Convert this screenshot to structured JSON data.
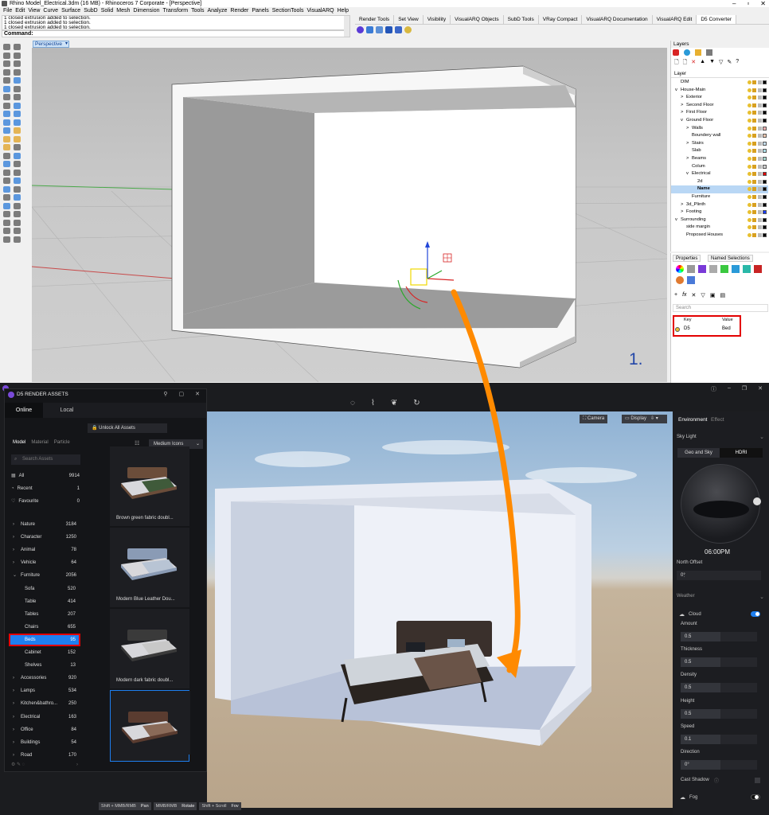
{
  "rhino": {
    "title": "Rhino Model_Electrical.3dm (16 MB) - Rhinoceros 7 Corporate - [Perspective]",
    "menu": [
      "File",
      "Edit",
      "View",
      "Curve",
      "Surface",
      "SubD",
      "Solid",
      "Mesh",
      "Dimension",
      "Transform",
      "Tools",
      "Analyze",
      "Render",
      "Panels",
      "SectionTools",
      "VisualARQ",
      "Help"
    ],
    "command_history": [
      "1 closed extrusion added to selection.",
      "1 closed extrusion added to selection.",
      "1 closed extrusion added to selection."
    ],
    "command_prompt": "Command:",
    "toolbar_tabs": [
      "Render Tools",
      "Set View",
      "Visibility",
      "VisualARQ Objects",
      "SubD Tools",
      "VRay Compact",
      "VisualARQ Documentation",
      "VisualARQ Edit",
      "D5 Converter"
    ],
    "active_toolbar_tab": "D5 Converter",
    "viewport_label": "Perspective",
    "viewport_number": "1.",
    "layers_panel_title": "Layers",
    "layer_header": "Layer",
    "layers": [
      {
        "name": "DIM",
        "indent": 0,
        "expander": "",
        "color": "#000000"
      },
      {
        "name": "House-Main",
        "indent": 0,
        "expander": "v",
        "color": "#000000"
      },
      {
        "name": "Exterior",
        "indent": 1,
        "expander": ">",
        "color": "#000000"
      },
      {
        "name": "Second Floor",
        "indent": 1,
        "expander": ">",
        "color": "#000000"
      },
      {
        "name": "First Floor",
        "indent": 1,
        "expander": ">",
        "color": "#000000"
      },
      {
        "name": "Ground Floor",
        "indent": 1,
        "expander": "v",
        "color": "#000000"
      },
      {
        "name": "Walls",
        "indent": 2,
        "expander": ">",
        "color": "#f0b0b0"
      },
      {
        "name": "Boundery wall",
        "indent": 2,
        "expander": "",
        "color": "#f0c8b0"
      },
      {
        "name": "Stairs",
        "indent": 2,
        "expander": ">",
        "color": "#c8e0f0"
      },
      {
        "name": "Slab",
        "indent": 2,
        "expander": "",
        "color": "#b0e0e8"
      },
      {
        "name": "Beams",
        "indent": 2,
        "expander": ">",
        "color": "#a8d8d0"
      },
      {
        "name": "Colum",
        "indent": 2,
        "expander": "",
        "color": "#d0d0d0"
      },
      {
        "name": "Electrical",
        "indent": 2,
        "expander": "v",
        "color": "#e00000"
      },
      {
        "name": "2d",
        "indent": 3,
        "expander": "",
        "color": "#000000"
      },
      {
        "name": "Name",
        "indent": 3,
        "expander": "",
        "color": "#000000",
        "selected": true
      },
      {
        "name": "Furniture",
        "indent": 2,
        "expander": "",
        "color": "#000000"
      },
      {
        "name": "3d_Plinth",
        "indent": 1,
        "expander": ">",
        "color": "#000000"
      },
      {
        "name": "Footing",
        "indent": 1,
        "expander": ">",
        "color": "#1a3cff"
      },
      {
        "name": "Surrounding",
        "indent": 0,
        "expander": "v",
        "color": "#000000"
      },
      {
        "name": "side margin",
        "indent": 1,
        "expander": "",
        "color": "#000000"
      },
      {
        "name": "Proposed Houses",
        "indent": 1,
        "expander": "",
        "color": "#000000"
      }
    ],
    "properties_tab": "Properties",
    "named_selections_tab": "Named Selections",
    "search_placeholder": "Search",
    "kv_header": {
      "key": "Key",
      "value": "Value"
    },
    "kv_rows": [
      {
        "key": "D5",
        "value": "Bed"
      }
    ]
  },
  "d5": {
    "panel_title": "D5 RENDER ASSETS",
    "tabs": [
      "Online",
      "Local"
    ],
    "active_tab": "Online",
    "unlock_label": "Unlock All Assets",
    "filter_tabs": [
      "Model",
      "Material",
      "Particle"
    ],
    "search_placeholder": "Search Assets",
    "view_mode": "Medium Icons",
    "top_items": [
      {
        "label": "All",
        "count": "9914",
        "icon": "grid-icon"
      },
      {
        "label": "Recent",
        "count": "1",
        "icon": "clock-icon"
      },
      {
        "label": "Favourite",
        "count": "0",
        "icon": "heart-icon"
      }
    ],
    "categories": [
      {
        "label": "Nature",
        "count": "3184",
        "expander": ">"
      },
      {
        "label": "Character",
        "count": "1250",
        "expander": ">"
      },
      {
        "label": "Animal",
        "count": "78",
        "expander": ">"
      },
      {
        "label": "Vehicle",
        "count": "64",
        "expander": ">"
      },
      {
        "label": "Furniture",
        "count": "2056",
        "expander": "v"
      },
      {
        "label": "Sofa",
        "count": "520",
        "expander": "",
        "sub": true
      },
      {
        "label": "Table",
        "count": "414",
        "expander": "",
        "sub": true
      },
      {
        "label": "Tables",
        "count": "207",
        "expander": "",
        "sub": true
      },
      {
        "label": "Chairs",
        "count": "655",
        "expander": "",
        "sub": true
      },
      {
        "label": "Beds",
        "count": "95",
        "expander": "",
        "sub": true,
        "selected": true
      },
      {
        "label": "Cabinet",
        "count": "152",
        "expander": "",
        "sub": true
      },
      {
        "label": "Shelves",
        "count": "13",
        "expander": "",
        "sub": true
      },
      {
        "label": "Accessories",
        "count": "920",
        "expander": ">"
      },
      {
        "label": "Lamps",
        "count": "534",
        "expander": ">"
      },
      {
        "label": "Kitchen&bathro...",
        "count": "250",
        "expander": ">"
      },
      {
        "label": "Electrical",
        "count": "163",
        "expander": ">"
      },
      {
        "label": "Office",
        "count": "84",
        "expander": ">"
      },
      {
        "label": "Buildings",
        "count": "54",
        "expander": ">"
      },
      {
        "label": "Road",
        "count": "170",
        "expander": ">"
      }
    ],
    "asset_cards": [
      {
        "caption": "Brown green fabric doubl...",
        "blanket": "#3f5a3a",
        "frame": "#6b4d3a"
      },
      {
        "caption": "Modern Blue Leather Dou...",
        "blanket": "#b8c4d4",
        "frame": "#8a9bb5"
      },
      {
        "caption": "Modern dark fabric doubl...",
        "blanket": "#c8c8c8",
        "frame": "#3a3a3a"
      },
      {
        "caption": "",
        "blanket": "#8a6a58",
        "frame": "#5a3c30"
      }
    ],
    "viewport_buttons": [
      "Camera",
      "Display"
    ],
    "env_tabs": [
      "Environment",
      "Effect"
    ],
    "sky_light_label": "Sky Light",
    "sky_modes": [
      "Geo and Sky",
      "HDRI"
    ],
    "time": "06:00PM",
    "north_offset_label": "North Offset",
    "north_offset_value": "0°",
    "weather_label": "Weather",
    "cloud_label": "Cloud",
    "weather_fields": [
      {
        "label": "Amount",
        "value": "0.5"
      },
      {
        "label": "Thickness",
        "value": "0.5"
      },
      {
        "label": "Density",
        "value": "0.5"
      },
      {
        "label": "Height",
        "value": "0.5"
      },
      {
        "label": "Speed",
        "value": "0.1"
      },
      {
        "label": "Direction",
        "value": "0°"
      }
    ],
    "cast_shadow_label": "Cast Shadow",
    "fog_label": "Fog",
    "shortcuts": [
      {
        "keys": "Shift + MMB/RMB",
        "action": "Pan"
      },
      {
        "keys": "MMB/RMB",
        "action": "Rotate"
      },
      {
        "keys": "Shift + Scroll",
        "action": "Fov"
      }
    ],
    "accent_color": "#1e7ff0",
    "highlight_color": "#e30000",
    "arrow_color": "#ff8a00"
  }
}
